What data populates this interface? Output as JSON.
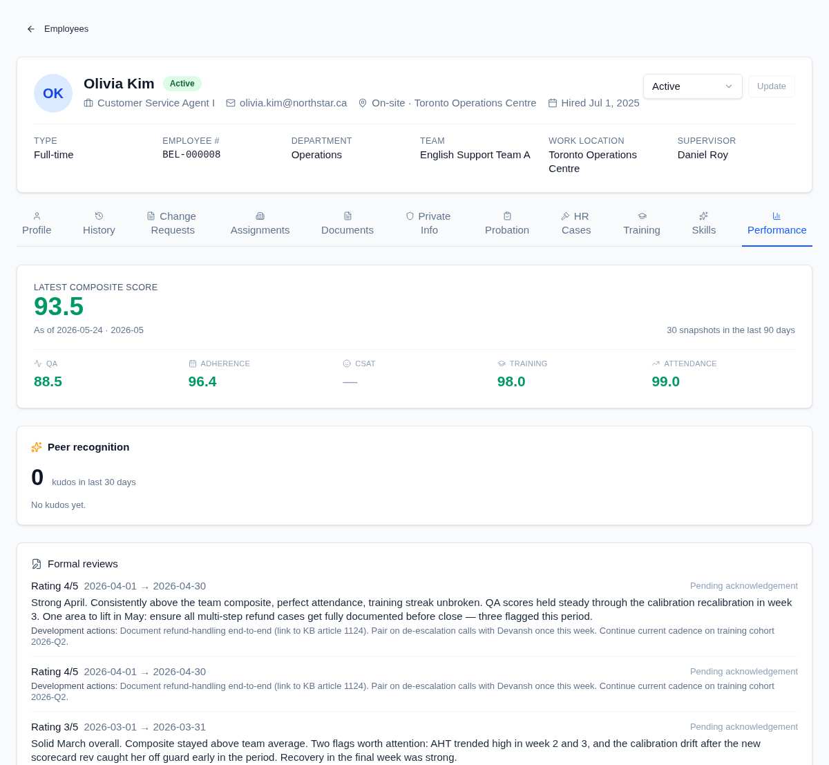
{
  "back_link": {
    "label": "Employees"
  },
  "header": {
    "initials": "OK",
    "name": "Olivia Kim",
    "status_badge": "Active",
    "meta": [
      {
        "kind": "role",
        "text": "Customer Service Agent I"
      },
      {
        "kind": "email",
        "text": "olivia.kim@northstar.ca"
      },
      {
        "kind": "location",
        "text": "On-site · Toronto Operations Centre"
      },
      {
        "kind": "date",
        "text": "Hired Jul 1, 2025"
      }
    ],
    "status_select": {
      "value": "Active"
    },
    "update_button": {
      "label": "Update",
      "disabled": true
    },
    "details": [
      {
        "label": "TYPE",
        "value": "Full-time",
        "kind": "text"
      },
      {
        "label": "EMPLOYEE #",
        "value": "BEL-000008",
        "kind": "code"
      },
      {
        "label": "DEPARTMENT",
        "value": "Operations",
        "kind": "text"
      },
      {
        "label": "TEAM",
        "value": "English Support Team A",
        "kind": "text"
      },
      {
        "label": "WORK LOCATION",
        "value": "Toronto Operations Centre",
        "kind": "text"
      },
      {
        "label": "SUPERVISOR",
        "value": "Daniel Roy",
        "kind": "text"
      }
    ]
  },
  "tabs": [
    {
      "label": "Profile",
      "selected": false
    },
    {
      "label": "History",
      "selected": false
    },
    {
      "label": "Change Requests",
      "selected": false
    },
    {
      "label": "Assignments",
      "selected": false
    },
    {
      "label": "Documents",
      "selected": false
    },
    {
      "label": "Private Info",
      "selected": false
    },
    {
      "label": "Probation",
      "selected": false
    },
    {
      "label": "HR Cases",
      "selected": false
    },
    {
      "label": "Training",
      "selected": false
    },
    {
      "label": "Skills",
      "selected": false
    },
    {
      "label": "Performance",
      "selected": true
    }
  ],
  "composite": {
    "label": "LATEST COMPOSITE SCORE",
    "score": "93.5",
    "as_of": "As of 2026-05-24 · 2026-05",
    "snapshots": "30 snapshots in the last 90 days",
    "metrics": [
      {
        "label": "QA",
        "value": "88.5",
        "kind": "score"
      },
      {
        "label": "ADHERENCE",
        "value": "96.4",
        "kind": "score"
      },
      {
        "label": "CSAT",
        "value": "—",
        "kind": "empty"
      },
      {
        "label": "TRAINING",
        "value": "98.0",
        "kind": "score"
      },
      {
        "label": "ATTENDANCE",
        "value": "99.0",
        "kind": "score"
      }
    ]
  },
  "peer_recognition": {
    "title": "Peer recognition",
    "count": "0",
    "count_label": "kudos in last 30 days",
    "empty_text": "No kudos yet."
  },
  "formal_reviews": {
    "title": "Formal reviews",
    "reviews": [
      {
        "rating": "Rating 4/5",
        "period": "2026-04-01 → 2026-04-30",
        "status": "Pending acknowledgement",
        "summary": "Strong April. Consistently above the team composite, perfect attendance, training streak unbroken. QA scores held steady through the calibration recalibration in week 3. One area to lift in May: ensure all multi-step refund cases get fully documented before close — three flagged this period.",
        "actions": "**Development actions:** Document refund-handling end-to-end (link to KB article 1124). Pair on de-escalation calls with Devansh once this week. Continue current cadence on training cohort 2026-Q2."
      },
      {
        "rating": "Rating 4/5",
        "period": "2026-04-01 → 2026-04-30",
        "status": "Pending acknowledgement",
        "actions": "**Development actions:** Document refund-handling end-to-end (link to KB article 1124). Pair on de-escalation calls with Devansh once this week. Continue current cadence on training cohort 2026-Q2."
      },
      {
        "rating": "Rating 3/5",
        "period": "2026-03-01 → 2026-03-31",
        "status": "Pending acknowledgement",
        "summary": "Solid March overall. Composite stayed above team average. Two flags worth attention: AHT trended high in week 2 and 3, and the calibration drift after the new scorecard rev caught her off guard early in the period. Recovery in the final week was strong."
      }
    ]
  }
}
